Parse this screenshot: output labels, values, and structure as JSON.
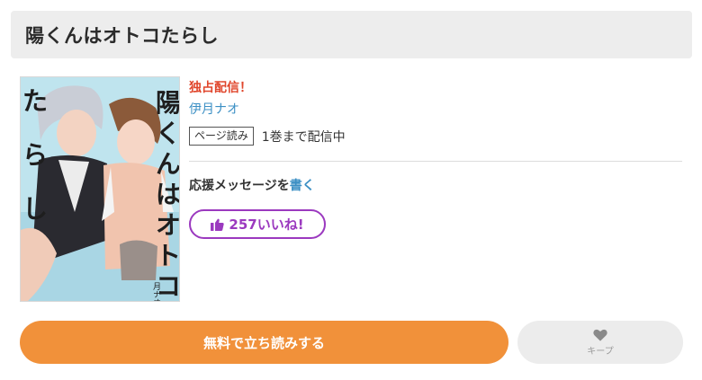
{
  "title": "陽くんはオトコたらし",
  "cover": {
    "title_vertical": "陽くんはオトコたらし",
    "author_small": "月ナオ"
  },
  "info": {
    "exclusive": "独占配信！",
    "author": "伊月ナオ",
    "format_badge": "ページ読み",
    "volume_status": "1巻まで配信中",
    "support_text": "応援メッセージを",
    "support_link": "書く",
    "likes": "257いいね!"
  },
  "actions": {
    "read_label": "無料で立ち読みする",
    "keep_label": "キープ"
  },
  "colors": {
    "accent_orange": "#f1913a",
    "like_purple": "#9b39bf",
    "exclusive_red": "#e0462c",
    "link_blue": "#3b8fc4"
  }
}
